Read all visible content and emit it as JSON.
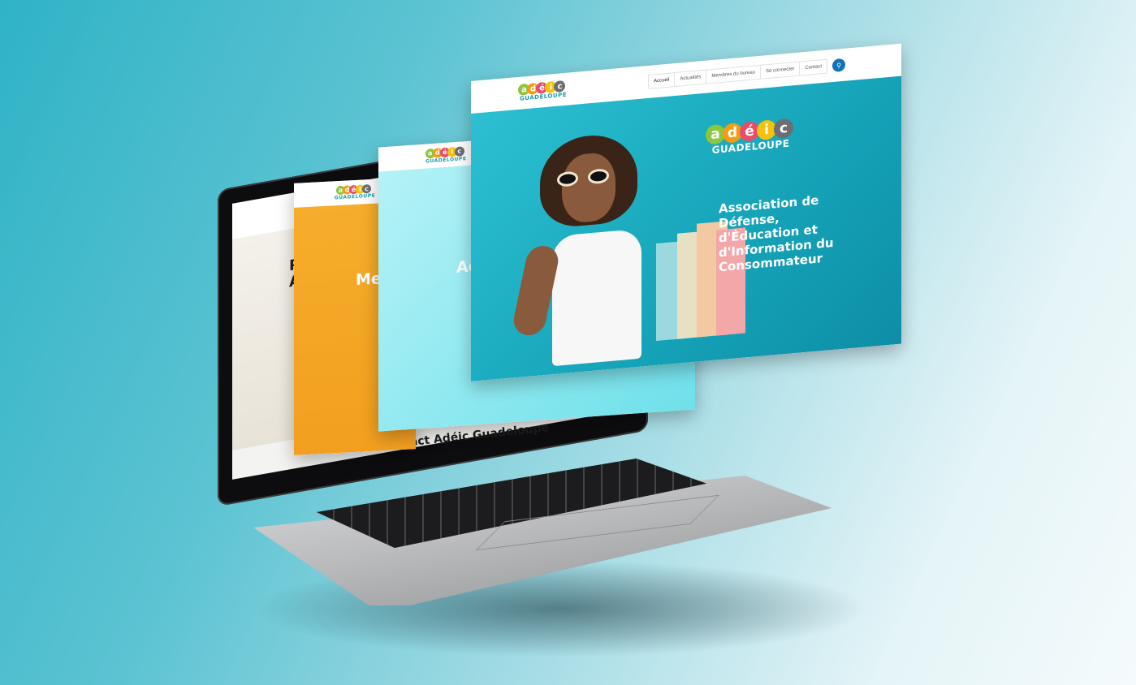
{
  "brand": {
    "letters": [
      "a",
      "d",
      "é",
      "i",
      "c"
    ],
    "letter_colors": [
      "#8cc63f",
      "#f39c12",
      "#e74c6c",
      "#f4c20d",
      "#6d6e71"
    ],
    "subtitle": "GUADELOUPE"
  },
  "laptop_screen": {
    "title_left": "Pr",
    "title_left2": "Ac",
    "contact_title": "Contact Adéic Guadeloupe"
  },
  "panel_members": {
    "title": "Mem",
    "accent": "#f5a623"
  },
  "panel_news": {
    "title": "Actu",
    "accent": "#8fe6ef"
  },
  "panel_home": {
    "nav": [
      "Accueil",
      "Actualités",
      "Membres du bureau",
      "Se connecter",
      "Contact"
    ],
    "search_icon": "search-icon",
    "hero_heading_lines": [
      "Association de",
      "Défense,",
      "d'Éducation et",
      "d'Information du",
      "Consommateur"
    ],
    "accent": "#17a7bd"
  }
}
